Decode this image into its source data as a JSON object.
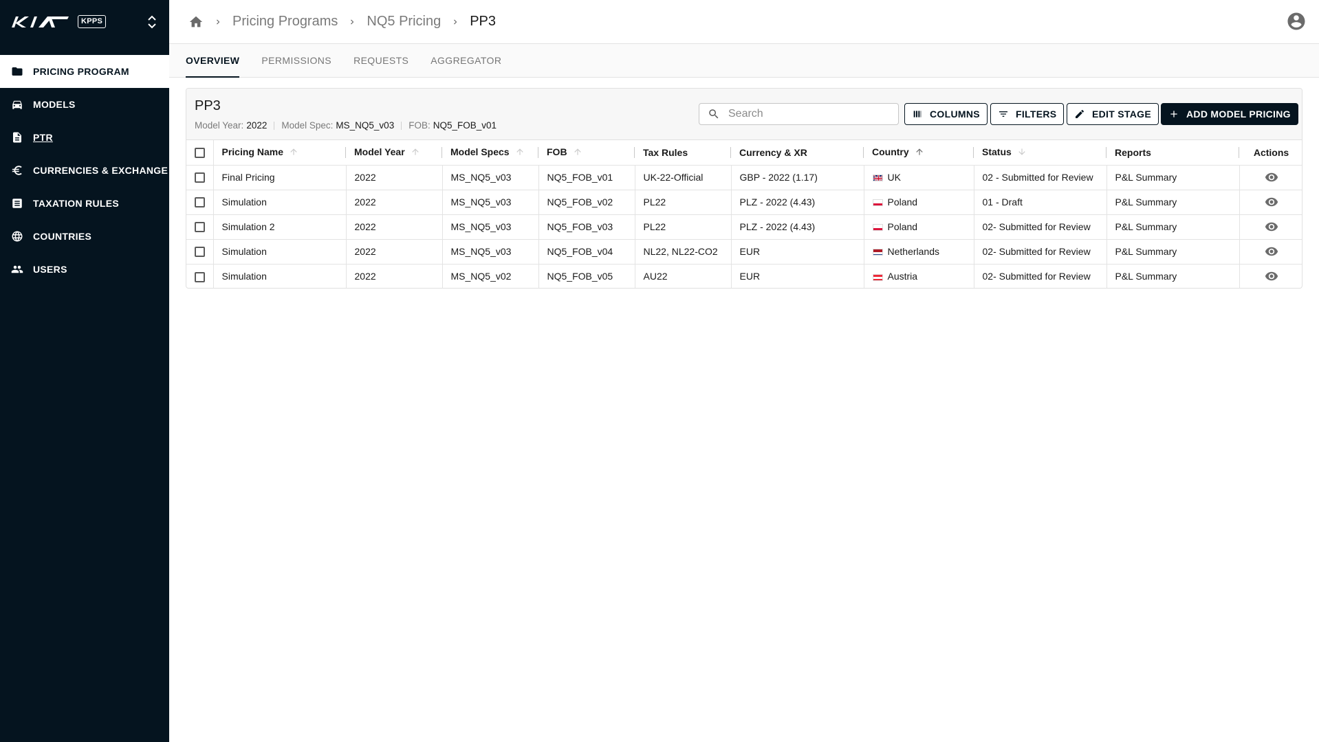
{
  "app": {
    "brand_badge": "KPPS"
  },
  "sidebar": {
    "items": [
      {
        "label": "PRICING PROGRAM",
        "icon": "folder-icon"
      },
      {
        "label": "MODELS",
        "icon": "car-icon"
      },
      {
        "label": "PTR",
        "icon": "document-icon"
      },
      {
        "label": "CURRENCIES & EXCHANGE",
        "icon": "euro-icon"
      },
      {
        "label": "TAXATION RULES",
        "icon": "list-icon"
      },
      {
        "label": "COUNTRIES",
        "icon": "globe-icon"
      },
      {
        "label": "USERS",
        "icon": "users-icon"
      }
    ]
  },
  "breadcrumb": {
    "items": [
      "Pricing Programs",
      "NQ5 Pricing"
    ],
    "current": "PP3"
  },
  "tabs": [
    "OVERVIEW",
    "PERMISSIONS",
    "REQUESTS",
    "AGGREGATOR"
  ],
  "panel": {
    "title": "PP3",
    "meta": [
      {
        "label": "Model Year:",
        "value": "2022"
      },
      {
        "label": "Model Spec:",
        "value": "MS_NQ5_v03"
      },
      {
        "label": "FOB:",
        "value": "NQ5_FOB_v01"
      }
    ],
    "search_placeholder": "Search",
    "buttons": {
      "columns": "COLUMNS",
      "filters": "FILTERS",
      "edit_stage": "EDIT STAGE",
      "add_model_pricing": "ADD MODEL PRICING"
    }
  },
  "table": {
    "headers": [
      "Pricing Name",
      "Model Year",
      "Model Specs",
      "FOB",
      "Tax Rules",
      "Currency & XR",
      "Country",
      "Status",
      "Reports",
      "Actions"
    ],
    "rows": [
      {
        "name": "Final Pricing",
        "year": "2022",
        "specs": "MS_NQ5_v03",
        "fob": "NQ5_FOB_v01",
        "tax": "UK-22-Official",
        "currency": "GBP - 2022 (1.17)",
        "country": "UK",
        "flag": "uk",
        "status": "02 - Submitted for Review",
        "report": "P&L Summary"
      },
      {
        "name": "Simulation",
        "year": "2022",
        "specs": "MS_NQ5_v03",
        "fob": "NQ5_FOB_v02",
        "tax": "PL22",
        "currency": "PLZ - 2022 (4.43)",
        "country": "Poland",
        "flag": "pl",
        "status": "01 - Draft",
        "report": "P&L Summary"
      },
      {
        "name": "Simulation 2",
        "year": "2022",
        "specs": "MS_NQ5_v03",
        "fob": "NQ5_FOB_v03",
        "tax": "PL22",
        "currency": "PLZ - 2022 (4.43)",
        "country": "Poland",
        "flag": "pl",
        "status": "02- Submitted for Review",
        "report": "P&L Summary"
      },
      {
        "name": "Simulation",
        "year": "2022",
        "specs": "MS_NQ5_v03",
        "fob": "NQ5_FOB_v04",
        "tax": "NL22, NL22-CO2",
        "currency": "EUR",
        "country": "Netherlands",
        "flag": "nl",
        "status": "02- Submitted for Review",
        "report": "P&L Summary"
      },
      {
        "name": "Simulation",
        "year": "2022",
        "specs": "MS_NQ5_v02",
        "fob": "NQ5_FOB_v05",
        "tax": "AU22",
        "currency": "EUR",
        "country": "Austria",
        "flag": "at",
        "status": "02- Submitted for Review",
        "report": "P&L Summary"
      }
    ]
  },
  "colors": {
    "sidebar_bg": "#05141f",
    "primary": "#05141f",
    "muted_text": "#7a7a7a"
  }
}
